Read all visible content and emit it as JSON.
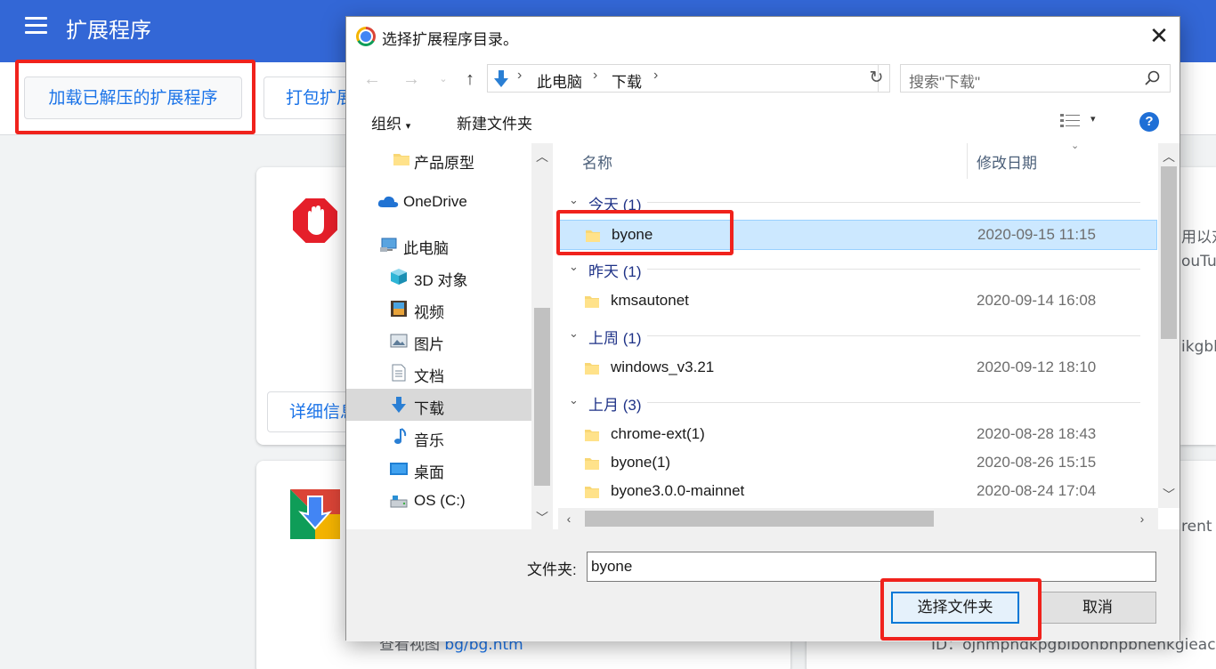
{
  "ext_page": {
    "title": "扩展程序",
    "load_unpacked": "加载已解压的扩展程序",
    "pack": "打包扩展程序",
    "details": "详细信息",
    "snippet_1": "用以对",
    "snippet_2": "ouTub",
    "snippet_3": "ikgbl",
    "snippet_4": "rent t",
    "view_label": "查看视图",
    "view_link": "bg/bg.htm",
    "id_text": "ID：ojnmphdkpgbibonbhpbhenkgieac"
  },
  "dialog": {
    "title": "选择扩展程序目录。",
    "close": "×",
    "address": {
      "crumbs": [
        "此电脑",
        "下载"
      ]
    },
    "search_placeholder": "搜索\"下载\"",
    "organize": "组织",
    "new_folder": "新建文件夹",
    "help": "?",
    "nav": [
      {
        "label": "产品原型",
        "icon": "folder-icon"
      },
      {
        "label": "OneDrive",
        "icon": "cloud-icon"
      },
      {
        "label": "此电脑",
        "icon": "computer-icon"
      },
      {
        "label": "3D 对象",
        "icon": "cube-icon"
      },
      {
        "label": "视频",
        "icon": "film-icon"
      },
      {
        "label": "图片",
        "icon": "picture-icon"
      },
      {
        "label": "文档",
        "icon": "document-icon"
      },
      {
        "label": "下载",
        "icon": "download-icon",
        "selected": true
      },
      {
        "label": "音乐",
        "icon": "music-icon"
      },
      {
        "label": "桌面",
        "icon": "desktop-icon"
      },
      {
        "label": "OS (C:)",
        "icon": "drive-icon"
      }
    ],
    "columns": {
      "name": "名称",
      "modified": "修改日期"
    },
    "groups": [
      {
        "label": "今天 (1)",
        "files": [
          {
            "name": "byone",
            "date": "2020-09-15 11:15",
            "selected": true
          }
        ]
      },
      {
        "label": "昨天 (1)",
        "files": [
          {
            "name": "kmsautonet",
            "date": "2020-09-14 16:08"
          }
        ]
      },
      {
        "label": "上周 (1)",
        "files": [
          {
            "name": "windows_v3.21",
            "date": "2020-09-12 18:10"
          }
        ]
      },
      {
        "label": "上月 (3)",
        "files": [
          {
            "name": "chrome-ext(1)",
            "date": "2020-08-28 18:43"
          },
          {
            "name": "byone(1)",
            "date": "2020-08-26 15:15"
          },
          {
            "name": "byone3.0.0-mainnet",
            "date": "2020-08-24 17:04"
          }
        ]
      }
    ],
    "folder_label": "文件夹:",
    "folder_value": "byone",
    "select_button": "选择文件夹",
    "cancel_button": "取消"
  },
  "colors": {
    "header_blue": "#3367d6",
    "highlight_red": "#f0221c",
    "selection": "#cce8ff",
    "primary_button_border": "#0078d7"
  }
}
